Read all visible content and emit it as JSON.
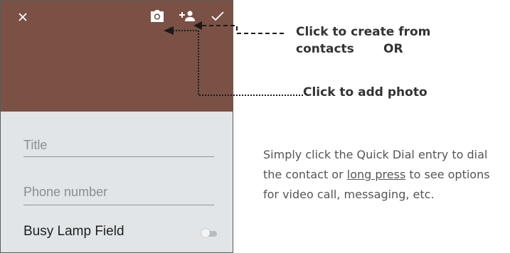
{
  "header": {
    "close_icon": "close-icon",
    "camera_icon": "camera-icon",
    "add_contact_icon": "add-contact-icon",
    "confirm_icon": "check-icon",
    "color": "#7a5144"
  },
  "form": {
    "title_placeholder": "Title",
    "phone_placeholder": "Phone number",
    "blf_label": "Busy Lamp Field",
    "blf_enabled": false,
    "color": "#e1e5e8"
  },
  "annotations": {
    "contacts_line1": "Click to create from",
    "contacts_line2": "contacts",
    "contacts_or": "OR",
    "photo": "Click to add photo",
    "desc_before": "Simply click the Quick Dial entry to dial the contact or ",
    "desc_link": "long press",
    "desc_after": " to see options for video call, messaging, etc."
  }
}
